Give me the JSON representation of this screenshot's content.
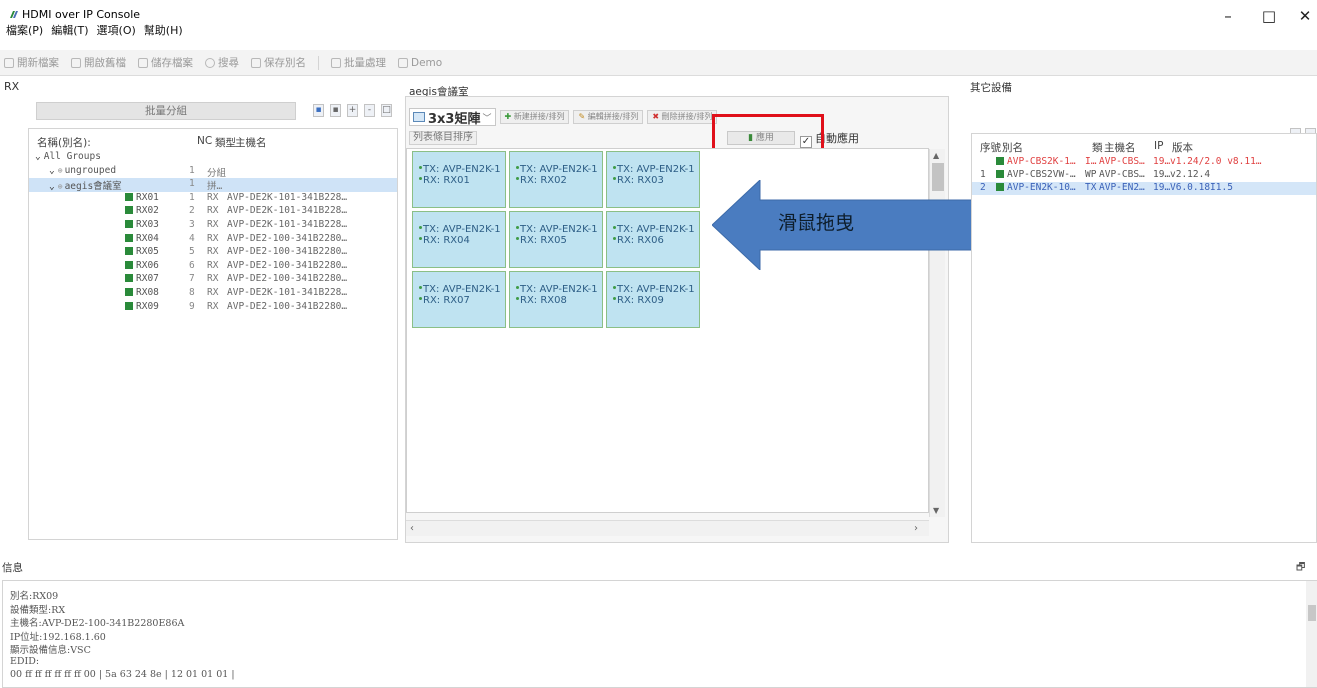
{
  "window": {
    "title": "HDMI over IP Console",
    "controls": {
      "minimize": "–",
      "maximize": "□",
      "close": "✕"
    }
  },
  "menu": [
    "檔案(P)",
    "編輯(T)",
    "選項(O)",
    "幫助(H)"
  ],
  "toolbar": {
    "items": [
      {
        "icon": "new-file-icon",
        "label": "開新檔案"
      },
      {
        "icon": "open-file-icon",
        "label": "開啟舊檔"
      },
      {
        "icon": "save-file-icon",
        "label": "儲存檔案"
      },
      {
        "icon": "search-icon",
        "label": "搜尋"
      },
      {
        "icon": "save-alias-icon",
        "label": "保存別名"
      },
      {
        "icon": "batch-icon",
        "label": "批量處理"
      },
      {
        "icon": "demo-icon",
        "label": "Demo"
      }
    ]
  },
  "rx_panel": {
    "title": "RX",
    "batch_group_button": "批量分組",
    "mini_buttons": [
      "▪",
      "▪",
      "+",
      "-",
      "□"
    ],
    "columns": {
      "name": "名稱(別名):",
      "nc": "NC",
      "type": "類型",
      "host": "主機名"
    },
    "tree": [
      {
        "level": 0,
        "name": "All Groups",
        "nc": "",
        "type": "",
        "host": "",
        "kind": "root"
      },
      {
        "level": 1,
        "name": "ungrouped",
        "nc": "1",
        "type": "分組",
        "host": "",
        "kind": "group"
      },
      {
        "level": 1,
        "name": "aegis會議室",
        "nc": "1",
        "type": "拼…",
        "host": "",
        "kind": "group",
        "selected": true
      },
      {
        "level": 2,
        "name": "RX01",
        "nc": "1",
        "type": "RX",
        "host": "AVP-DE2K-101-341B228…",
        "kind": "device"
      },
      {
        "level": 2,
        "name": "RX02",
        "nc": "2",
        "type": "RX",
        "host": "AVP-DE2K-101-341B228…",
        "kind": "device"
      },
      {
        "level": 2,
        "name": "RX03",
        "nc": "3",
        "type": "RX",
        "host": "AVP-DE2K-101-341B228…",
        "kind": "device"
      },
      {
        "level": 2,
        "name": "RX04",
        "nc": "4",
        "type": "RX",
        "host": "AVP-DE2-100-341B2280…",
        "kind": "device"
      },
      {
        "level": 2,
        "name": "RX05",
        "nc": "5",
        "type": "RX",
        "host": "AVP-DE2-100-341B2280…",
        "kind": "device"
      },
      {
        "level": 2,
        "name": "RX06",
        "nc": "6",
        "type": "RX",
        "host": "AVP-DE2-100-341B2280…",
        "kind": "device"
      },
      {
        "level": 2,
        "name": "RX07",
        "nc": "7",
        "type": "RX",
        "host": "AVP-DE2-100-341B2280…",
        "kind": "device"
      },
      {
        "level": 2,
        "name": "RX08",
        "nc": "8",
        "type": "RX",
        "host": "AVP-DE2K-101-341B228…",
        "kind": "device"
      },
      {
        "level": 2,
        "name": "RX09",
        "nc": "9",
        "type": "RX",
        "host": "AVP-DE2-100-341B2280…",
        "kind": "device"
      }
    ]
  },
  "matrix_panel": {
    "title": "aegis會議室",
    "matrix_select": "3x3矩陣",
    "buttons": [
      "新建拼接/排列",
      "編輯拼接/排列",
      "刪除拼接/排列"
    ],
    "sort_label": "列表條目排序",
    "apply_label": "應用",
    "auto_apply_label": "自動應用",
    "cells": [
      {
        "tx": "TX: AVP-EN2K-1",
        "rx": "RX: RX01"
      },
      {
        "tx": "TX: AVP-EN2K-1",
        "rx": "RX: RX02"
      },
      {
        "tx": "TX: AVP-EN2K-1",
        "rx": "RX: RX03"
      },
      {
        "tx": "TX: AVP-EN2K-1",
        "rx": "RX: RX04"
      },
      {
        "tx": "TX: AVP-EN2K-1",
        "rx": "RX: RX05"
      },
      {
        "tx": "TX: AVP-EN2K-1",
        "rx": "RX: RX06"
      },
      {
        "tx": "TX: AVP-EN2K-1",
        "rx": "RX: RX07"
      },
      {
        "tx": "TX: AVP-EN2K-1",
        "rx": "RX: RX08"
      },
      {
        "tx": "TX: AVP-EN2K-1",
        "rx": "RX: RX09"
      }
    ]
  },
  "annotation": {
    "arrow_text": "滑鼠拖曳",
    "arrow_color": "#4a7cc0",
    "highlight_color": "#e0101a"
  },
  "other_devices": {
    "title": "其它設備",
    "columns": {
      "no": "序號",
      "alias": "別名",
      "type": "類",
      "host": "主機名",
      "ip": "IP",
      "version": "版本"
    },
    "rows": [
      {
        "no": "",
        "alias": "AVP-CBS2K-1…",
        "type": "I…",
        "host": "AVP-CBS…",
        "ip": "19…",
        "version": "v1.24/2.0 v8.11…",
        "color": "#e04040"
      },
      {
        "no": "1",
        "alias": "AVP-CBS2VW-…",
        "type": "WP",
        "host": "AVP-CBS…",
        "ip": "19…",
        "version": "v2.12.4",
        "color": "#555555"
      },
      {
        "no": "2",
        "alias": "AVP-EN2K-10…",
        "type": "TX",
        "host": "AVP-EN2…",
        "ip": "19…",
        "version": "V6.0.18I1.5",
        "color": "#3b62b8",
        "selected": true
      }
    ]
  },
  "info_panel": {
    "title": "信息",
    "lines": [
      "別名:RX09",
      "設備類型:RX",
      "主機名:AVP-DE2-100-341B2280E86A",
      "IP位址:192.168.1.60",
      "顯示設備信息:VSC",
      "EDID:",
      "00 ff ff ff ff ff ff 00 | 5a 63 24 8e | 12 01 01 01 |"
    ]
  }
}
